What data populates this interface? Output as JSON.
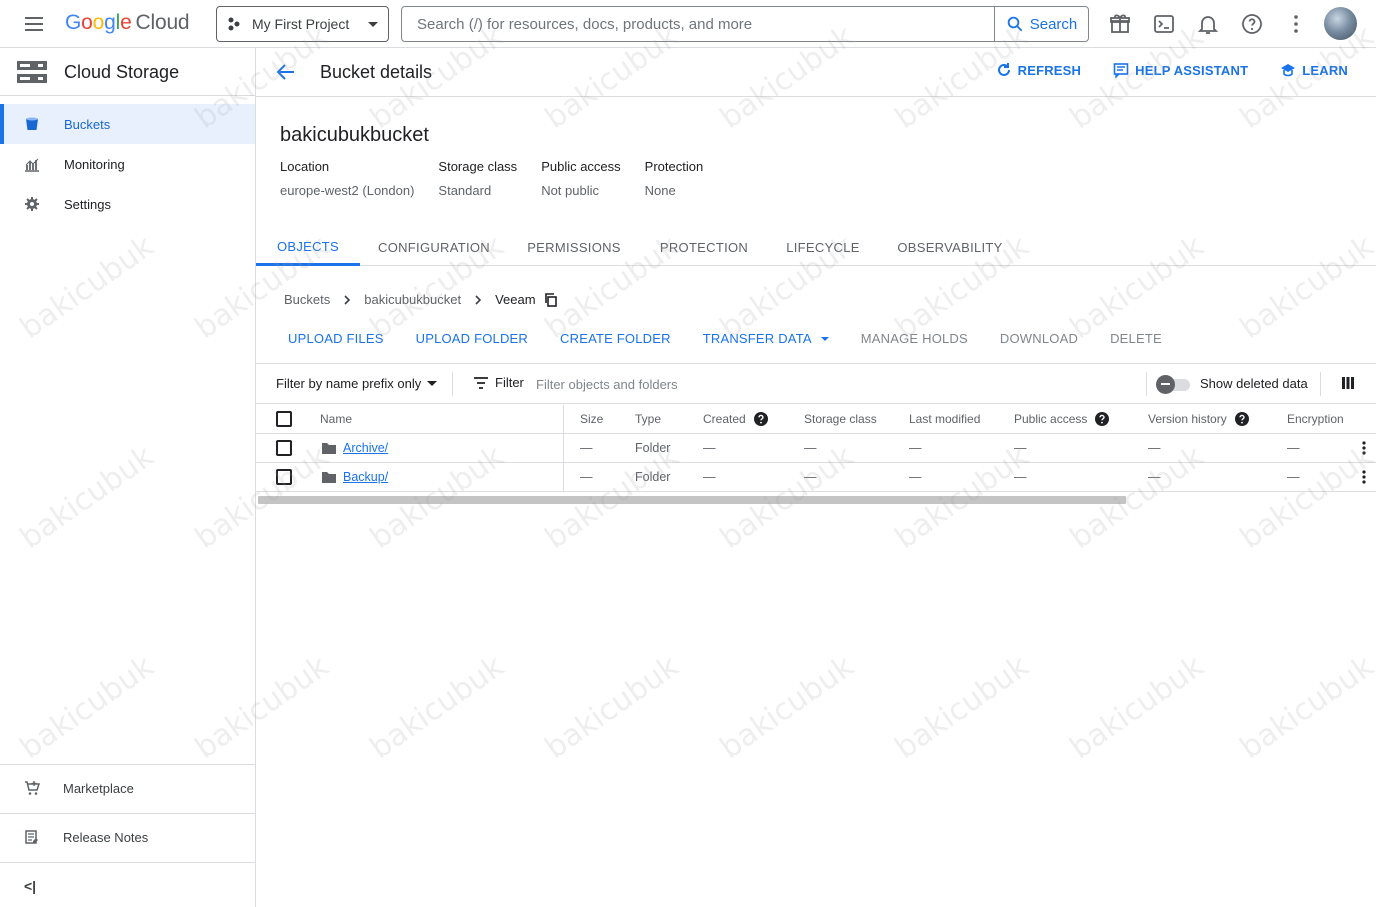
{
  "topbar": {
    "logo_google": "Google",
    "logo_cloud": "Cloud",
    "project": "My First Project",
    "search_placeholder": "Search (/) for resources, docs, products, and more",
    "search_button": "Search"
  },
  "sidebar": {
    "product_title": "Cloud Storage",
    "items": [
      {
        "label": "Buckets"
      },
      {
        "label": "Monitoring"
      },
      {
        "label": "Settings"
      }
    ],
    "bottom_items": [
      {
        "label": "Marketplace"
      },
      {
        "label": "Release Notes"
      }
    ],
    "collapse_label": "<|"
  },
  "header": {
    "title": "Bucket details",
    "actions": [
      {
        "label": "REFRESH"
      },
      {
        "label": "HELP ASSISTANT"
      },
      {
        "label": "LEARN"
      }
    ]
  },
  "bucket": {
    "name": "bakicubukbucket",
    "props": [
      {
        "label": "Location",
        "value": "europe-west2 (London)"
      },
      {
        "label": "Storage class",
        "value": "Standard"
      },
      {
        "label": "Public access",
        "value": "Not public"
      },
      {
        "label": "Protection",
        "value": "None"
      }
    ]
  },
  "tabs": [
    {
      "label": "OBJECTS"
    },
    {
      "label": "CONFIGURATION"
    },
    {
      "label": "PERMISSIONS"
    },
    {
      "label": "PROTECTION"
    },
    {
      "label": "LIFECYCLE"
    },
    {
      "label": "OBSERVABILITY"
    }
  ],
  "breadcrumb": [
    "Buckets",
    "bakicubukbucket",
    "Veeam"
  ],
  "actions": [
    {
      "label": "UPLOAD FILES"
    },
    {
      "label": "UPLOAD FOLDER"
    },
    {
      "label": "CREATE FOLDER"
    },
    {
      "label": "TRANSFER DATA"
    },
    {
      "label": "MANAGE HOLDS"
    },
    {
      "label": "DOWNLOAD"
    },
    {
      "label": "DELETE"
    }
  ],
  "filter": {
    "prefix_label": "Filter by name prefix only",
    "filter_label": "Filter",
    "placeholder": "Filter objects and folders",
    "toggle_label": "Show deleted data"
  },
  "table": {
    "columns": [
      "Name",
      "Size",
      "Type",
      "Created",
      "Storage class",
      "Last modified",
      "Public access",
      "Version history",
      "Encryption"
    ],
    "rows": [
      {
        "name": "Archive/",
        "size": "—",
        "type": "Folder",
        "created": "—",
        "storage_class": "—",
        "last_modified": "—",
        "public_access": "—",
        "version_history": "—",
        "encryption": "—"
      },
      {
        "name": "Backup/",
        "size": "—",
        "type": "Folder",
        "created": "—",
        "storage_class": "—",
        "last_modified": "—",
        "public_access": "—",
        "version_history": "—",
        "encryption": "—"
      }
    ]
  },
  "watermark_text": "bakicubuk",
  "colors": {
    "accent": "#1a73e8",
    "active_bg": "#e8f0fe",
    "border": "#dadce0"
  }
}
